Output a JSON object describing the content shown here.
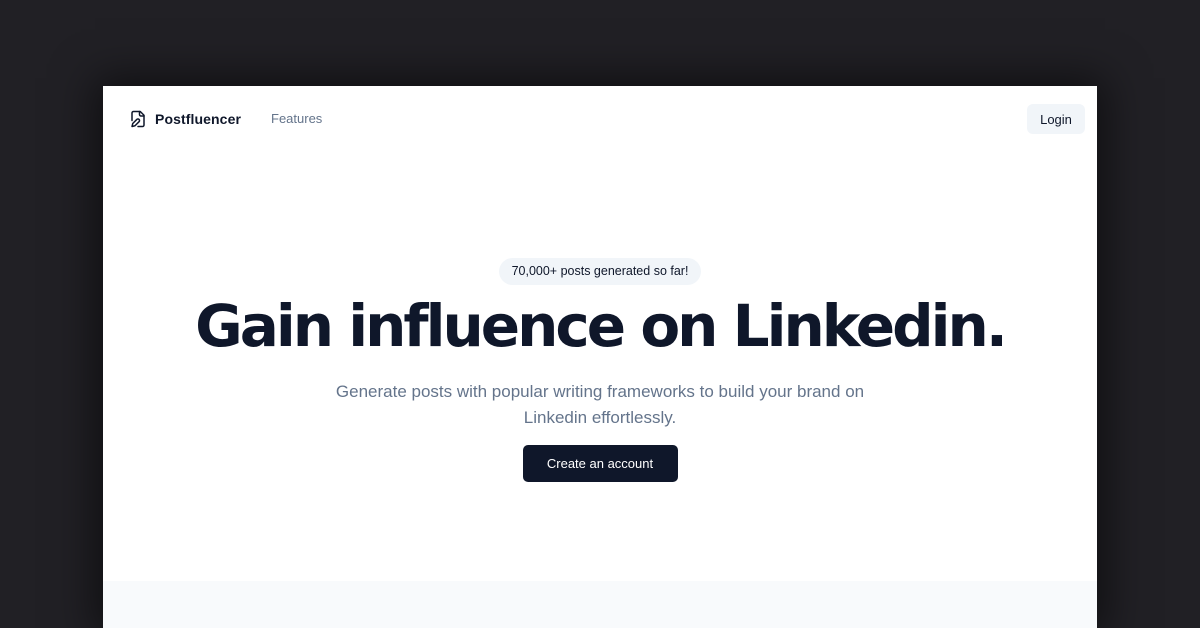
{
  "brand": {
    "name": "Postfluencer",
    "icon": "file-pen-icon"
  },
  "nav": {
    "links": [
      {
        "label": "Features"
      }
    ],
    "login_label": "Login"
  },
  "hero": {
    "badge": "70,000+ posts generated so far!",
    "headline": "Gain influence on Linkedin.",
    "subtitle": "Generate posts with popular writing frameworks to build your brand on Linkedin effortlessly.",
    "cta_label": "Create an account"
  },
  "colors": {
    "backdrop": "#212025",
    "page_background": "#ffffff",
    "primary_text": "#0f172a",
    "muted_text": "#64748b",
    "button_dark": "#0f172a",
    "button_light": "#f1f5f9",
    "section_background": "#f8fafc"
  }
}
